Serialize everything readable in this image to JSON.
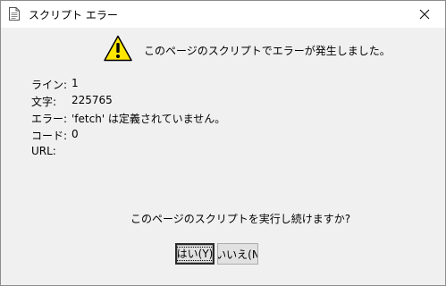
{
  "window": {
    "title": "スクリプト エラー",
    "icon": "document-icon"
  },
  "dialog": {
    "headline": "このページのスクリプトでエラーが発生しました。",
    "icon": "warning-icon",
    "fields": [
      {
        "label": "ライン:",
        "value": "1"
      },
      {
        "label": "文字:",
        "value": "225765"
      },
      {
        "label": "エラー:",
        "value": "'fetch' は定義されていません。"
      },
      {
        "label": "コード:",
        "value": "0"
      },
      {
        "label": "URL:",
        "value": ""
      }
    ],
    "question": "このページのスクリプトを実行し続けますか?",
    "buttons": {
      "yes": "はい(Y)",
      "no": "いいえ(N"
    }
  },
  "colors": {
    "background": "#f0f0f0",
    "titlebar": "#ffffff",
    "warning_yellow": "#ffe600"
  }
}
